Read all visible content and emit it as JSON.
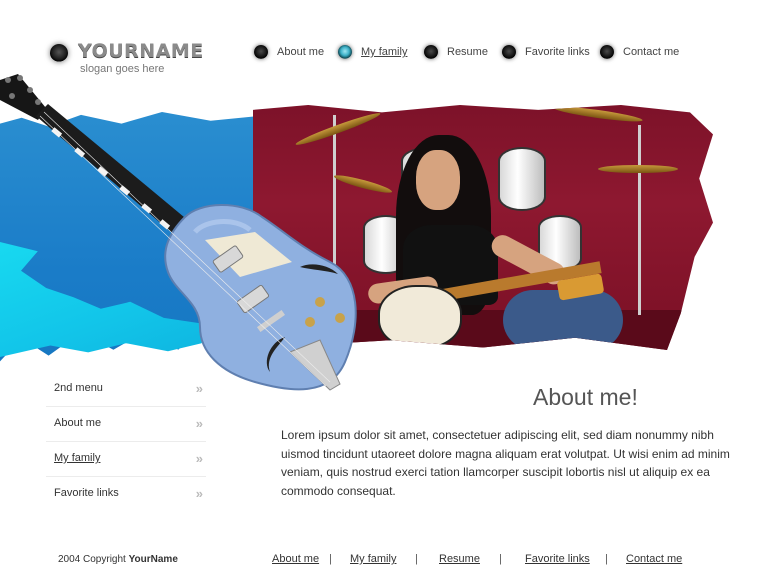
{
  "header": {
    "logo_name": "YOURNAME",
    "slogan": "slogan goes here",
    "nav": [
      {
        "label": "About me",
        "active": false
      },
      {
        "label": "My family",
        "active": true
      },
      {
        "label": "Resume",
        "active": false
      },
      {
        "label": "Favorite links",
        "active": false
      },
      {
        "label": "Contact me",
        "active": false
      }
    ]
  },
  "sidebar": {
    "items": [
      {
        "label": "2nd menu",
        "active": false
      },
      {
        "label": "About me",
        "active": false
      },
      {
        "label": "My family",
        "active": true
      },
      {
        "label": "Favorite links",
        "active": false
      }
    ],
    "arrow_glyph": "»"
  },
  "main": {
    "title": "About me!",
    "body": "Lorem ipsum dolor sit amet, consectetuer adipiscing elit, sed diam nonummy nibh uismod tincidunt utaoreet dolore magna aliquam erat volutpat. Ut wisi enim ad minim veniam, quis nostrud exerci tation llamcorper suscipit lobortis nisl ut aliquip ex ea commodo consequat."
  },
  "footer": {
    "copyright_prefix": "2004 Copyright",
    "copyright_name": "YourName",
    "links": [
      "About me",
      "My family",
      "Resume",
      "Favorite links",
      "Contact me"
    ],
    "separator": "|"
  },
  "colors": {
    "accent_blue": "#1a7cc8",
    "accent_cyan": "#18d9f0",
    "photo_red": "#8e1830",
    "active_dot": "#3db1c8"
  }
}
